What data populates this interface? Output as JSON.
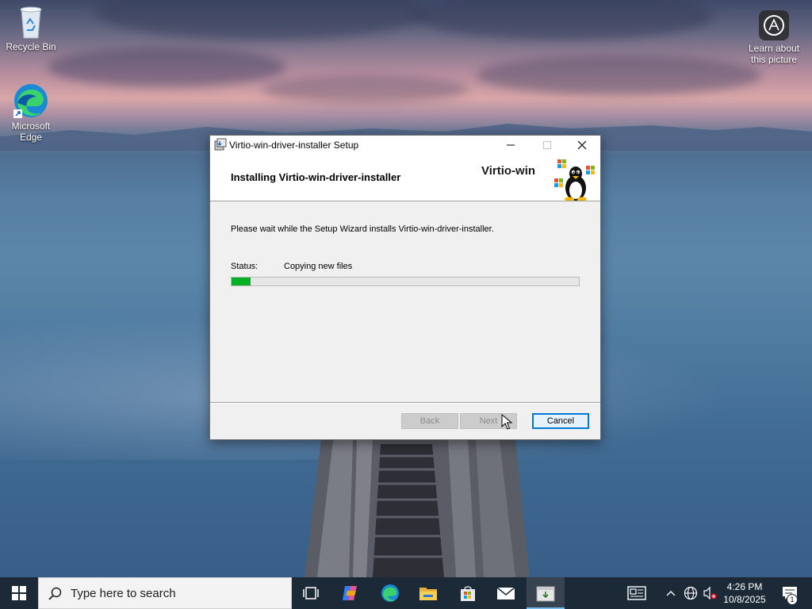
{
  "desktop": {
    "icons": [
      {
        "label": "Recycle Bin",
        "icon": "recycle-bin-icon"
      },
      {
        "label": "Microsoft Edge",
        "icon": "edge-icon"
      }
    ],
    "spotlight": {
      "label": "Learn about this picture",
      "icon": "camera-info-icon"
    }
  },
  "installer": {
    "window_title": "Virtio-win-driver-installer Setup",
    "header_title": "Installing Virtio-win-driver-installer",
    "brand": "Virtio-win",
    "description": "Please wait while the Setup Wizard installs Virtio-win-driver-installer.",
    "status_label": "Status:",
    "status_value": "Copying new files",
    "progress_fraction": 0.055,
    "buttons": {
      "back": "Back",
      "next": "Next",
      "cancel": "Cancel"
    },
    "colors": {
      "progress": "#06b025",
      "default_button_border": "#0078d7"
    }
  },
  "taskbar": {
    "search_placeholder": "Type here to search",
    "pinned": [
      "task-view-icon",
      "copilot-icon",
      "edge-icon",
      "file-explorer-icon",
      "store-icon",
      "mail-icon",
      "installer-icon"
    ],
    "clock_time": "4:26 PM",
    "clock_date": "10/8/2025",
    "notification_count": "1",
    "background": "#1c2a38"
  }
}
